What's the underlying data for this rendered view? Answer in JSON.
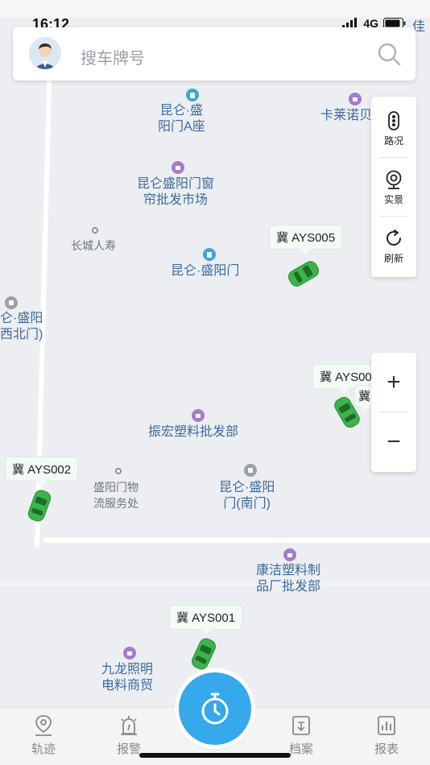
{
  "status_bar": {
    "time": "16:12",
    "network": "4G"
  },
  "search": {
    "placeholder": "搜车牌号"
  },
  "map": {
    "pois": {
      "kunlun_a_line1": "昆仑·盛",
      "kunlun_a_line2": "阳门A座",
      "kalainuo": "卡莱诺贝",
      "curtain_line1": "昆仑盛阳门窗",
      "curtain_line2": "帘批发市场",
      "changcheng": "长城人寿",
      "kunlun_main": "昆仑·盛阳门",
      "west_line1": "仑·盛阳",
      "west_line2": "西北门)",
      "zhenhong": "振宏塑料批发部",
      "logistics_line1": "盛阳门物",
      "logistics_line2": "流服务处",
      "south_line1": "昆仑·盛阳",
      "south_line2": "门(南门)",
      "kangjie_line1": "康洁塑料制",
      "kangjie_line2": "品厂批发部",
      "jiulong_line1": "九龙照明",
      "jiulong_line2": "电料商贸",
      "top_right": "佳",
      "edge_right": "冀"
    },
    "vehicles": [
      {
        "plate": "冀 AYS005"
      },
      {
        "plate": "冀 AYS00"
      },
      {
        "plate": "冀 AYS002"
      },
      {
        "plate": "冀 AYS001"
      }
    ],
    "car_color": "#3bb54a"
  },
  "tools": {
    "traffic": "路况",
    "street_view": "实景",
    "refresh": "刷新"
  },
  "zoom": {
    "in": "+",
    "out": "−"
  },
  "tabs": {
    "track": "轨迹",
    "alarm": "报警",
    "archive": "档案",
    "report": "报表"
  },
  "colors": {
    "accent": "#36a8ec",
    "poi_text": "#3b6a9f"
  }
}
